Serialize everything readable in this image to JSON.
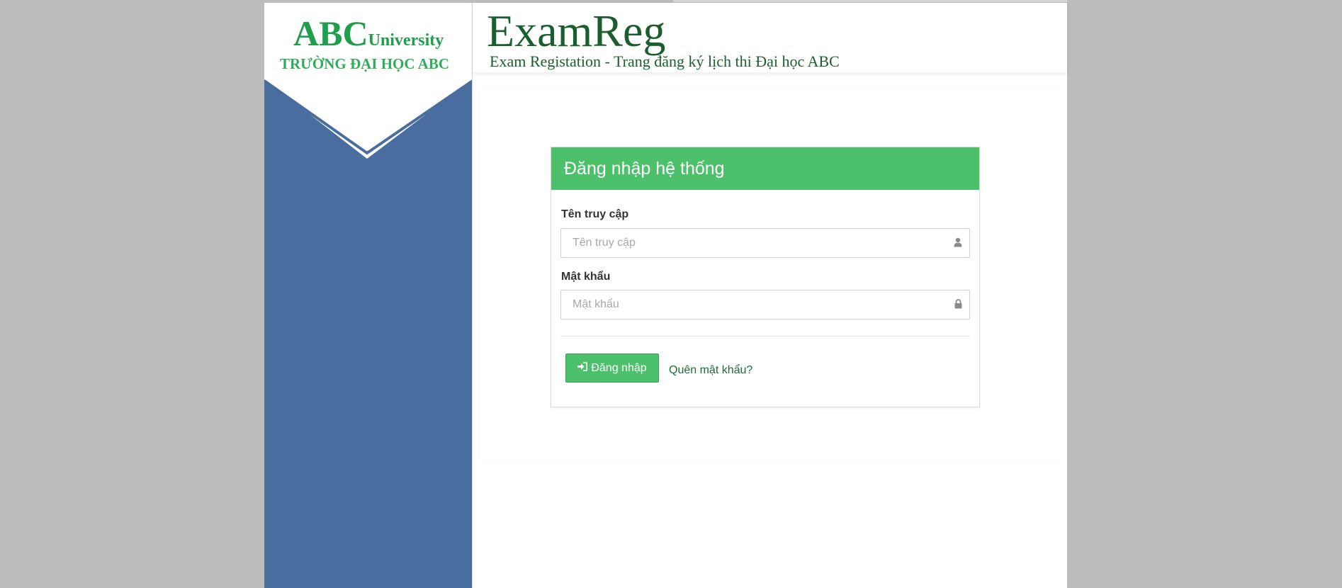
{
  "sidebar": {
    "logo_abc": "ABC",
    "logo_university": "University",
    "school_name": "TRƯỜNG ĐẠI HỌC ABC"
  },
  "header": {
    "app_title": "ExamReg",
    "subtitle": "Exam Registation - Trang đăng ký lịch thi Đại học ABC"
  },
  "login": {
    "title": "Đăng nhập hệ thống",
    "username_label": "Tên truy cập",
    "username_placeholder": "Tên truy cập",
    "password_label": "Mật khẩu",
    "password_placeholder": "Mật khẩu",
    "submit_label": "Đăng nhập",
    "forgot_label": "Quên mật khẩu?"
  },
  "icons": {
    "username": "user-icon",
    "password": "lock-icon",
    "submit": "sign-in-icon"
  },
  "colors": {
    "brand_green": "#4cc06a",
    "sidebar_blue": "#4a6d9f",
    "title_green": "#1b5e2d",
    "logo_green": "#1f9e4b"
  }
}
